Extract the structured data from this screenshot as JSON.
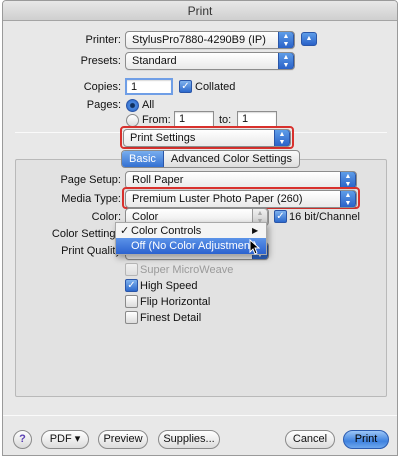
{
  "window": {
    "title": "Print"
  },
  "printer": {
    "label": "Printer:",
    "value": "StylusPro7880-4290B9 (IP)"
  },
  "presets": {
    "label": "Presets:",
    "value": "Standard"
  },
  "copies": {
    "label": "Copies:",
    "value": "1",
    "collated_label": "Collated",
    "collated": true
  },
  "pages": {
    "label": "Pages:",
    "all_label": "All",
    "from_label": "From:",
    "from_value": "1",
    "to_label": "to:",
    "to_value": "1",
    "selected": "All"
  },
  "section_popup": {
    "value": "Print Settings"
  },
  "tabs": [
    {
      "label": "Basic",
      "selected": true
    },
    {
      "label": "Advanced Color Settings",
      "selected": false
    }
  ],
  "page_setup": {
    "label": "Page Setup:",
    "value": "Roll Paper"
  },
  "media_type": {
    "label": "Media Type:",
    "value": "Premium Luster Photo Paper (260)"
  },
  "color": {
    "label": "Color:",
    "value": "Color",
    "bit_label": "16 bit/Channel",
    "bit_checked": true
  },
  "color_settings": {
    "label": "Color Settings"
  },
  "print_quality": {
    "label": "Print Quality"
  },
  "color_menu": {
    "items": [
      {
        "label": "Color Controls",
        "checked": true,
        "submenu": true,
        "highlighted": false
      },
      {
        "label": "Off (No Color Adjustment)",
        "checked": false,
        "submenu": false,
        "highlighted": true
      }
    ]
  },
  "options": [
    {
      "label": "Super MicroWeave",
      "checked": false,
      "disabled": true
    },
    {
      "label": "High Speed",
      "checked": true,
      "disabled": false
    },
    {
      "label": "Flip Horizontal",
      "checked": false,
      "disabled": false
    },
    {
      "label": "Finest Detail",
      "checked": false,
      "disabled": false
    }
  ],
  "footer": {
    "help": "?",
    "pdf_label": "PDF ▾",
    "preview_label": "Preview",
    "supplies_label": "Supplies...",
    "cancel_label": "Cancel",
    "print_label": "Print"
  },
  "colors": {
    "highlight_red": "#d8312d",
    "accent_blue": "#2b62cf"
  }
}
